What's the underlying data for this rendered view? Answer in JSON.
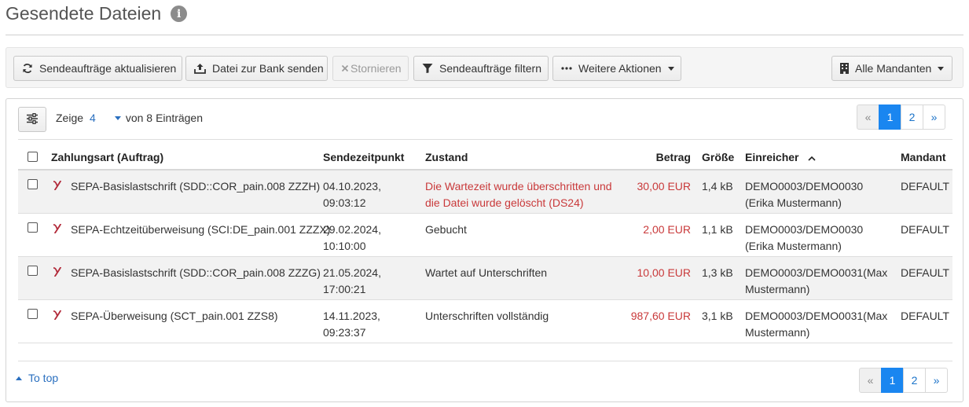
{
  "page": {
    "title": "Gesendete Dateien"
  },
  "toolbar": {
    "refresh_label": "Sendeaufträge aktualisieren",
    "send_label": "Datei zur Bank senden",
    "cancel_label": "Stornieren",
    "filter_label": "Sendeaufträge filtern",
    "more_label": "Weitere Aktionen",
    "clients_label": "Alle Mandanten"
  },
  "listing": {
    "show_label": "Zeige",
    "page_size": "4",
    "of_label": "von 8",
    "entries_label": "Einträgen"
  },
  "pagination": {
    "prev": "«",
    "pages": [
      "1",
      "2"
    ],
    "active_page": "1",
    "next": "»"
  },
  "table": {
    "columns": {
      "type": "Zahlungsart (Auftrag)",
      "sent": "Sendezeitpunkt",
      "state": "Zustand",
      "amount": "Betrag",
      "size": "Größe",
      "submitter": "Einreicher",
      "client": "Mandant"
    },
    "sort": {
      "column": "submitter",
      "direction": "ascending"
    },
    "rows": [
      {
        "type": "SEPA-Basislastschrift (SDD::COR_pain.008 ZZZH)",
        "date": "04.10.2023,",
        "time": "09:03:12",
        "state_line1": "Die Wartezeit wurde überschritten und",
        "state_line2": "die Datei wurde gelöscht (DS24)",
        "state_is_error": true,
        "amount": "30,00 EUR",
        "size": "1,4 kB",
        "submitter_line1": "DEMO0003/DEMO0030",
        "submitter_line2": "(Erika Mustermann)",
        "client": "DEFAULT"
      },
      {
        "type": "SEPA-Echtzeitüberweisung (SCI:DE_pain.001 ZZZX)",
        "date": "29.02.2024,",
        "time": "10:10:00",
        "state_line1": "Gebucht",
        "state_line2": "",
        "state_is_error": false,
        "amount": "2,00 EUR",
        "size": "1,1 kB",
        "submitter_line1": "DEMO0003/DEMO0030",
        "submitter_line2": "(Erika Mustermann)",
        "client": "DEFAULT"
      },
      {
        "type": "SEPA-Basislastschrift (SDD::COR_pain.008 ZZZG)",
        "date": "21.05.2024,",
        "time": "17:00:21",
        "state_line1": "Wartet auf Unterschriften",
        "state_line2": "",
        "state_is_error": false,
        "amount": "10,00 EUR",
        "size": "1,3 kB",
        "submitter_line1": "DEMO0003/DEMO0031(Max",
        "submitter_line2": "Mustermann)",
        "client": "DEFAULT"
      },
      {
        "type": "SEPA-Überweisung (SCT_pain.001 ZZS8)",
        "date": "14.11.2023,",
        "time": "09:23:37",
        "state_line1": "Unterschriften vollständig",
        "state_line2": "",
        "state_is_error": false,
        "amount": "987,60 EUR",
        "size": "3,1 kB",
        "submitter_line1": "DEMO0003/DEMO0031(Max",
        "submitter_line2": "Mustermann)",
        "client": "DEFAULT"
      }
    ]
  },
  "footer": {
    "to_top_label": "To top"
  },
  "colors": {
    "accent": "#1a86f0",
    "link": "#2a6fbf",
    "error_text": "#c9393a",
    "amount_text": "#c9393a",
    "sepa_icon": "#b22a3a"
  },
  "icons": {
    "info": "info-icon",
    "refresh": "refresh-icon",
    "upload": "upload-icon",
    "cancel": "x-icon",
    "filter": "filter-icon",
    "more": "ellipsis-icon",
    "clients": "building-icon",
    "settings": "sliders-icon",
    "sepa": "sepa-icon",
    "sort": "chevron-up-icon",
    "to_top": "caret-up-icon"
  }
}
